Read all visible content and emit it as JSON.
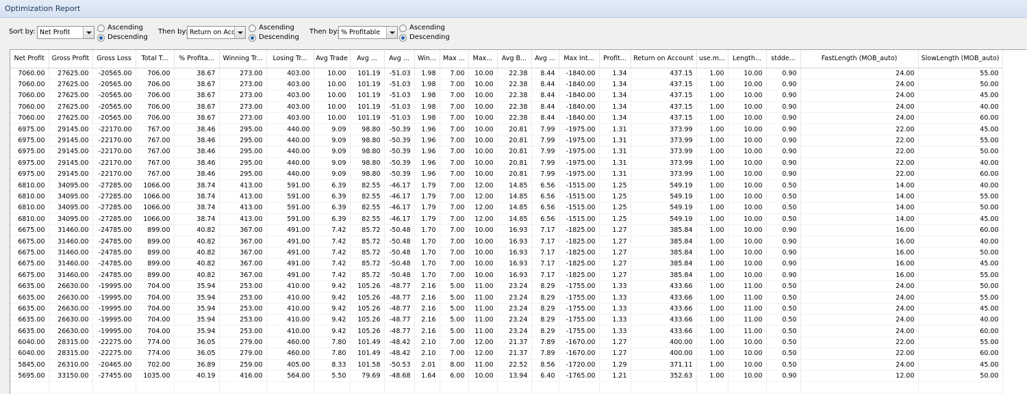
{
  "window": {
    "title": "Optimization Report"
  },
  "sort": {
    "sort_by_label": "Sort by:",
    "sort_by_value": "Net Profit",
    "then_by1_label": "Then by:",
    "then_by1_value": "Return on Acc",
    "then_by2_label": "Then by:",
    "then_by2_value": "% Profitable",
    "ascending": "Ascending",
    "descending": "Descending"
  },
  "table": {
    "columns": [
      "Net Profit",
      "Gross Profit",
      "Gross Loss",
      "Total T...",
      "% Profita...",
      "Winning Tr...",
      "Losing Tr...",
      "Avg Trade",
      "Avg ...",
      "Avg ...",
      "Win...",
      "Max ...",
      "Max...",
      "Avg B...",
      "Avg ...",
      "Max Int...",
      "Profit...",
      "Return on Account",
      "use.m...",
      "Length...",
      "stdde...",
      "FastLength (MOB_auto)",
      "SlowLength (MOB_auto)"
    ],
    "rows": [
      [
        "7060.00",
        "27625.00",
        "-20565.00",
        "706.00",
        "38.67",
        "273.00",
        "403.00",
        "10.00",
        "101.19",
        "-51.03",
        "1.98",
        "7.00",
        "10.00",
        "22.38",
        "8.44",
        "-1840.00",
        "1.34",
        "437.15",
        "1.00",
        "10.00",
        "0.90",
        "24.00",
        "55.00"
      ],
      [
        "7060.00",
        "27625.00",
        "-20565.00",
        "706.00",
        "38.67",
        "273.00",
        "403.00",
        "10.00",
        "101.19",
        "-51.03",
        "1.98",
        "7.00",
        "10.00",
        "22.38",
        "8.44",
        "-1840.00",
        "1.34",
        "437.15",
        "1.00",
        "10.00",
        "0.90",
        "24.00",
        "50.00"
      ],
      [
        "7060.00",
        "27625.00",
        "-20565.00",
        "706.00",
        "38.67",
        "273.00",
        "403.00",
        "10.00",
        "101.19",
        "-51.03",
        "1.98",
        "7.00",
        "10.00",
        "22.38",
        "8.44",
        "-1840.00",
        "1.34",
        "437.15",
        "1.00",
        "10.00",
        "0.90",
        "24.00",
        "45.00"
      ],
      [
        "7060.00",
        "27625.00",
        "-20565.00",
        "706.00",
        "38.67",
        "273.00",
        "403.00",
        "10.00",
        "101.19",
        "-51.03",
        "1.98",
        "7.00",
        "10.00",
        "22.38",
        "8.44",
        "-1840.00",
        "1.34",
        "437.15",
        "1.00",
        "10.00",
        "0.90",
        "24.00",
        "40.00"
      ],
      [
        "7060.00",
        "27625.00",
        "-20565.00",
        "706.00",
        "38.67",
        "273.00",
        "403.00",
        "10.00",
        "101.19",
        "-51.03",
        "1.98",
        "7.00",
        "10.00",
        "22.38",
        "8.44",
        "-1840.00",
        "1.34",
        "437.15",
        "1.00",
        "10.00",
        "0.90",
        "24.00",
        "60.00"
      ],
      [
        "6975.00",
        "29145.00",
        "-22170.00",
        "767.00",
        "38.46",
        "295.00",
        "440.00",
        "9.09",
        "98.80",
        "-50.39",
        "1.96",
        "7.00",
        "10.00",
        "20.81",
        "7.99",
        "-1975.00",
        "1.31",
        "373.99",
        "1.00",
        "10.00",
        "0.90",
        "22.00",
        "45.00"
      ],
      [
        "6975.00",
        "29145.00",
        "-22170.00",
        "767.00",
        "38.46",
        "295.00",
        "440.00",
        "9.09",
        "98.80",
        "-50.39",
        "1.96",
        "7.00",
        "10.00",
        "20.81",
        "7.99",
        "-1975.00",
        "1.31",
        "373.99",
        "1.00",
        "10.00",
        "0.90",
        "22.00",
        "55.00"
      ],
      [
        "6975.00",
        "29145.00",
        "-22170.00",
        "767.00",
        "38.46",
        "295.00",
        "440.00",
        "9.09",
        "98.80",
        "-50.39",
        "1.96",
        "7.00",
        "10.00",
        "20.81",
        "7.99",
        "-1975.00",
        "1.31",
        "373.99",
        "1.00",
        "10.00",
        "0.90",
        "22.00",
        "50.00"
      ],
      [
        "6975.00",
        "29145.00",
        "-22170.00",
        "767.00",
        "38.46",
        "295.00",
        "440.00",
        "9.09",
        "98.80",
        "-50.39",
        "1.96",
        "7.00",
        "10.00",
        "20.81",
        "7.99",
        "-1975.00",
        "1.31",
        "373.99",
        "1.00",
        "10.00",
        "0.90",
        "22.00",
        "40.00"
      ],
      [
        "6975.00",
        "29145.00",
        "-22170.00",
        "767.00",
        "38.46",
        "295.00",
        "440.00",
        "9.09",
        "98.80",
        "-50.39",
        "1.96",
        "7.00",
        "10.00",
        "20.81",
        "7.99",
        "-1975.00",
        "1.31",
        "373.99",
        "1.00",
        "10.00",
        "0.90",
        "22.00",
        "60.00"
      ],
      [
        "6810.00",
        "34095.00",
        "-27285.00",
        "1066.00",
        "38.74",
        "413.00",
        "591.00",
        "6.39",
        "82.55",
        "-46.17",
        "1.79",
        "7.00",
        "12.00",
        "14.85",
        "6.56",
        "-1515.00",
        "1.25",
        "549.19",
        "1.00",
        "10.00",
        "0.50",
        "14.00",
        "40.00"
      ],
      [
        "6810.00",
        "34095.00",
        "-27285.00",
        "1066.00",
        "38.74",
        "413.00",
        "591.00",
        "6.39",
        "82.55",
        "-46.17",
        "1.79",
        "7.00",
        "12.00",
        "14.85",
        "6.56",
        "-1515.00",
        "1.25",
        "549.19",
        "1.00",
        "10.00",
        "0.50",
        "14.00",
        "55.00"
      ],
      [
        "6810.00",
        "34095.00",
        "-27285.00",
        "1066.00",
        "38.74",
        "413.00",
        "591.00",
        "6.39",
        "82.55",
        "-46.17",
        "1.79",
        "7.00",
        "12.00",
        "14.85",
        "6.56",
        "-1515.00",
        "1.25",
        "549.19",
        "1.00",
        "10.00",
        "0.50",
        "14.00",
        "50.00"
      ],
      [
        "6810.00",
        "34095.00",
        "-27285.00",
        "1066.00",
        "38.74",
        "413.00",
        "591.00",
        "6.39",
        "82.55",
        "-46.17",
        "1.79",
        "7.00",
        "12.00",
        "14.85",
        "6.56",
        "-1515.00",
        "1.25",
        "549.19",
        "1.00",
        "10.00",
        "0.50",
        "14.00",
        "45.00"
      ],
      [
        "6675.00",
        "31460.00",
        "-24785.00",
        "899.00",
        "40.82",
        "367.00",
        "491.00",
        "7.42",
        "85.72",
        "-50.48",
        "1.70",
        "7.00",
        "10.00",
        "16.93",
        "7.17",
        "-1825.00",
        "1.27",
        "385.84",
        "1.00",
        "10.00",
        "0.90",
        "16.00",
        "60.00"
      ],
      [
        "6675.00",
        "31460.00",
        "-24785.00",
        "899.00",
        "40.82",
        "367.00",
        "491.00",
        "7.42",
        "85.72",
        "-50.48",
        "1.70",
        "7.00",
        "10.00",
        "16.93",
        "7.17",
        "-1825.00",
        "1.27",
        "385.84",
        "1.00",
        "10.00",
        "0.90",
        "16.00",
        "40.00"
      ],
      [
        "6675.00",
        "31460.00",
        "-24785.00",
        "899.00",
        "40.82",
        "367.00",
        "491.00",
        "7.42",
        "85.72",
        "-50.48",
        "1.70",
        "7.00",
        "10.00",
        "16.93",
        "7.17",
        "-1825.00",
        "1.27",
        "385.84",
        "1.00",
        "10.00",
        "0.90",
        "16.00",
        "50.00"
      ],
      [
        "6675.00",
        "31460.00",
        "-24785.00",
        "899.00",
        "40.82",
        "367.00",
        "491.00",
        "7.42",
        "85.72",
        "-50.48",
        "1.70",
        "7.00",
        "10.00",
        "16.93",
        "7.17",
        "-1825.00",
        "1.27",
        "385.84",
        "1.00",
        "10.00",
        "0.90",
        "16.00",
        "45.00"
      ],
      [
        "6675.00",
        "31460.00",
        "-24785.00",
        "899.00",
        "40.82",
        "367.00",
        "491.00",
        "7.42",
        "85.72",
        "-50.48",
        "1.70",
        "7.00",
        "10.00",
        "16.93",
        "7.17",
        "-1825.00",
        "1.27",
        "385.84",
        "1.00",
        "10.00",
        "0.90",
        "16.00",
        "55.00"
      ],
      [
        "6635.00",
        "26630.00",
        "-19995.00",
        "704.00",
        "35.94",
        "253.00",
        "410.00",
        "9.42",
        "105.26",
        "-48.77",
        "2.16",
        "5.00",
        "11.00",
        "23.24",
        "8.29",
        "-1755.00",
        "1.33",
        "433.66",
        "1.00",
        "11.00",
        "0.50",
        "24.00",
        "50.00"
      ],
      [
        "6635.00",
        "26630.00",
        "-19995.00",
        "704.00",
        "35.94",
        "253.00",
        "410.00",
        "9.42",
        "105.26",
        "-48.77",
        "2.16",
        "5.00",
        "11.00",
        "23.24",
        "8.29",
        "-1755.00",
        "1.33",
        "433.66",
        "1.00",
        "11.00",
        "0.50",
        "24.00",
        "55.00"
      ],
      [
        "6635.00",
        "26630.00",
        "-19995.00",
        "704.00",
        "35.94",
        "253.00",
        "410.00",
        "9.42",
        "105.26",
        "-48.77",
        "2.16",
        "5.00",
        "11.00",
        "23.24",
        "8.29",
        "-1755.00",
        "1.33",
        "433.66",
        "1.00",
        "11.00",
        "0.50",
        "24.00",
        "45.00"
      ],
      [
        "6635.00",
        "26630.00",
        "-19995.00",
        "704.00",
        "35.94",
        "253.00",
        "410.00",
        "9.42",
        "105.26",
        "-48.77",
        "2.16",
        "5.00",
        "11.00",
        "23.24",
        "8.29",
        "-1755.00",
        "1.33",
        "433.66",
        "1.00",
        "11.00",
        "0.50",
        "24.00",
        "40.00"
      ],
      [
        "6635.00",
        "26630.00",
        "-19995.00",
        "704.00",
        "35.94",
        "253.00",
        "410.00",
        "9.42",
        "105.26",
        "-48.77",
        "2.16",
        "5.00",
        "11.00",
        "23.24",
        "8.29",
        "-1755.00",
        "1.33",
        "433.66",
        "1.00",
        "11.00",
        "0.50",
        "24.00",
        "60.00"
      ],
      [
        "6040.00",
        "28315.00",
        "-22275.00",
        "774.00",
        "36.05",
        "279.00",
        "460.00",
        "7.80",
        "101.49",
        "-48.42",
        "2.10",
        "7.00",
        "12.00",
        "21.37",
        "7.89",
        "-1670.00",
        "1.27",
        "400.00",
        "1.00",
        "10.00",
        "0.50",
        "22.00",
        "55.00"
      ],
      [
        "6040.00",
        "28315.00",
        "-22275.00",
        "774.00",
        "36.05",
        "279.00",
        "460.00",
        "7.80",
        "101.49",
        "-48.42",
        "2.10",
        "7.00",
        "12.00",
        "21.37",
        "7.89",
        "-1670.00",
        "1.27",
        "400.00",
        "1.00",
        "10.00",
        "0.50",
        "22.00",
        "60.00"
      ],
      [
        "5845.00",
        "26310.00",
        "-20465.00",
        "702.00",
        "36.89",
        "259.00",
        "405.00",
        "8.33",
        "101.58",
        "-50.53",
        "2.01",
        "8.00",
        "11.00",
        "22.52",
        "8.56",
        "-1720.00",
        "1.29",
        "371.11",
        "1.00",
        "10.00",
        "0.50",
        "24.00",
        "45.00"
      ],
      [
        "5695.00",
        "33150.00",
        "-27455.00",
        "1035.00",
        "40.19",
        "416.00",
        "564.00",
        "5.50",
        "79.69",
        "-48.68",
        "1.64",
        "6.00",
        "10.00",
        "13.94",
        "6.40",
        "-1765.00",
        "1.21",
        "352.63",
        "1.00",
        "10.00",
        "0.90",
        "12.00",
        "50.00"
      ]
    ]
  }
}
